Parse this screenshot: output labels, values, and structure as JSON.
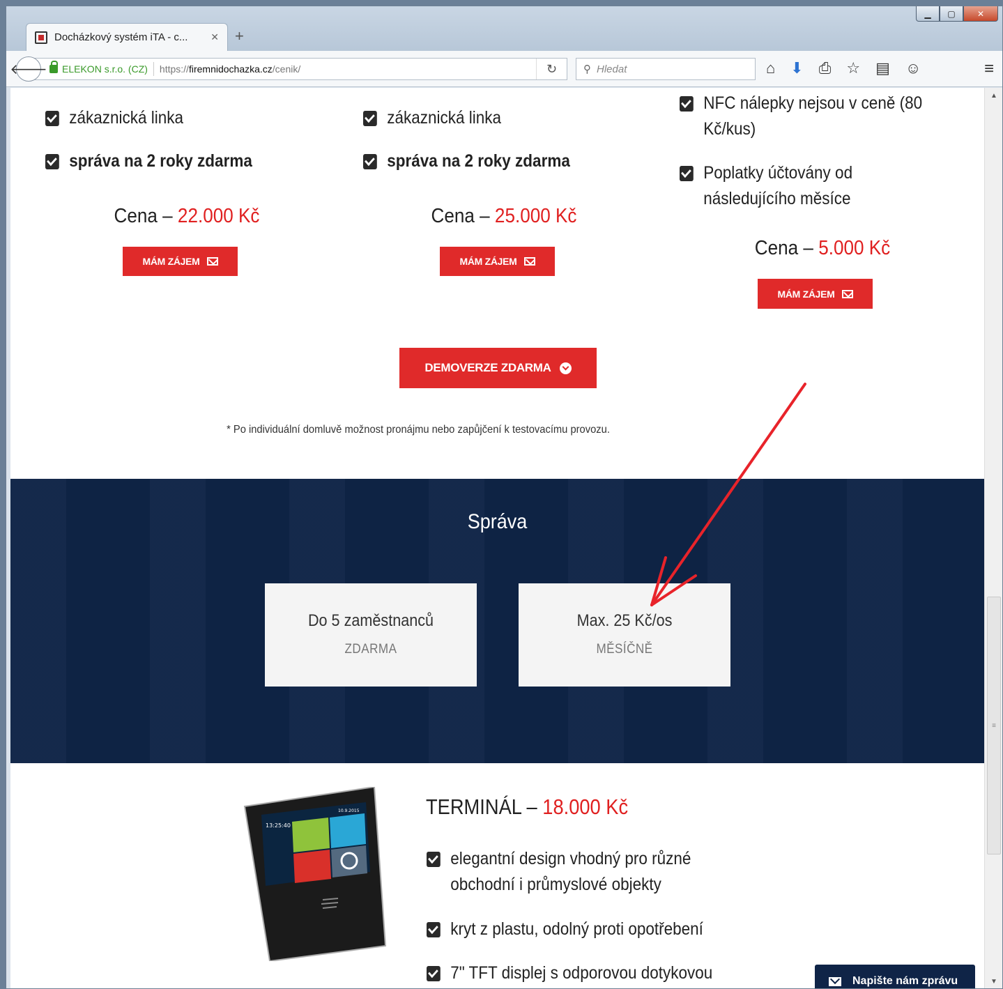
{
  "browser": {
    "tab_title": "Docházkový systém iTA - c...",
    "tab_close": "✕",
    "new_tab": "+",
    "identity_owner": "ELEKON s.r.o. (CZ)",
    "url_protocol": "https://",
    "url_host": "firemnidochazka.cz",
    "url_path": "/cenik/",
    "search_placeholder": "Hledat",
    "toolbar_icons": [
      "home-icon",
      "download-icon",
      "print-icon",
      "bookmark-star-icon",
      "library-icon",
      "chat-icon",
      "menu-icon"
    ]
  },
  "pricing": {
    "col1": {
      "items": [
        "zákaznická linka",
        "správa na 2 roky zdarma"
      ],
      "price_label": "Cena –",
      "price_amount": "22.000 Kč",
      "button": "MÁM ZÁJEM"
    },
    "col2": {
      "items": [
        "zákaznická linka",
        "správa na 2 roky zdarma"
      ],
      "price_label": "Cena –",
      "price_amount": "25.000 Kč",
      "button": "MÁM ZÁJEM"
    },
    "col3": {
      "items": [
        "NFC nálepky nejsou v ceně (80 Kč/kus)",
        "Poplatky účtovány od následujícího měsíce"
      ],
      "price_label": "Cena –",
      "price_amount": "5.000 Kč",
      "button": "MÁM ZÁJEM"
    },
    "demo_button": "DEMOVERZE ZDARMA",
    "footnote": "* Po individuální domluvě možnost pronájmu nebo zapůjčení k testovacímu provozu."
  },
  "sprava": {
    "title": "Správa",
    "cards": [
      {
        "title": "Do 5 zaměstnanců",
        "sub": "ZDARMA"
      },
      {
        "title": "Max. 25 Kč/os",
        "sub": "MĚSÍČNĚ"
      }
    ]
  },
  "terminal": {
    "title_label": "TERMINÁL –",
    "title_amount": "18.000 Kč",
    "screen_time": "13:25:40",
    "screen_date": "10.9.2015",
    "items": [
      "elegantní design vhodný pro různé obchodní i průmyslové objekty",
      "kryt z plastu, odolný proti opotřebení",
      "7\" TFT displej s odporovou dotykovou"
    ]
  },
  "chat": {
    "label": "Napište nám zprávu"
  },
  "colors": {
    "accent_red": "#e02a2a",
    "navy": "#0f2447",
    "annotation_arrow": "#e8232a"
  }
}
